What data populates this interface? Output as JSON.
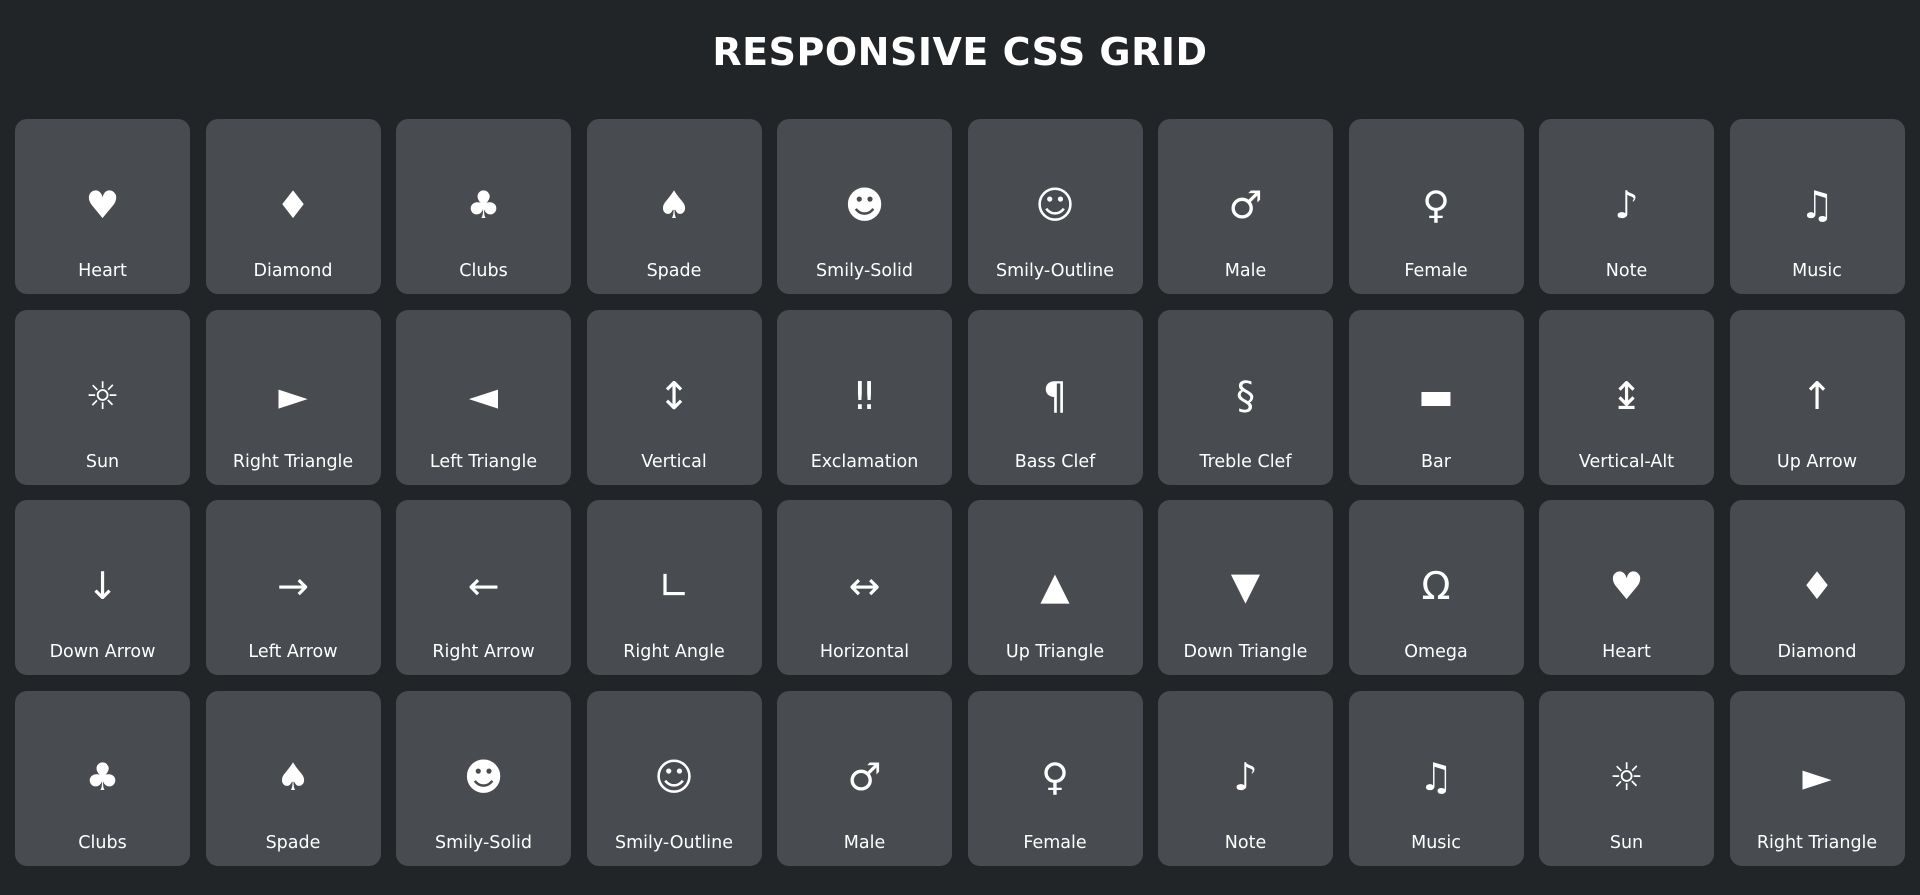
{
  "title": "RESPONSIVE CSS GRID",
  "tiles": [
    {
      "glyph": "♥",
      "label": "Heart",
      "icon": "heart-icon"
    },
    {
      "glyph": "♦",
      "label": "Diamond",
      "icon": "diamond-icon"
    },
    {
      "glyph": "♣",
      "label": "Clubs",
      "icon": "clubs-icon"
    },
    {
      "glyph": "♠",
      "label": "Spade",
      "icon": "spade-icon"
    },
    {
      "glyph": "☻",
      "label": "Smily-Solid",
      "icon": "smiley-solid-icon"
    },
    {
      "glyph": "☺",
      "label": "Smily-Outline",
      "icon": "smiley-outline-icon"
    },
    {
      "glyph": "♂",
      "label": "Male",
      "icon": "male-icon"
    },
    {
      "glyph": "♀",
      "label": "Female",
      "icon": "female-icon"
    },
    {
      "glyph": "♪",
      "label": "Note",
      "icon": "note-icon"
    },
    {
      "glyph": "♫",
      "label": "Music",
      "icon": "music-icon"
    },
    {
      "glyph": "☼",
      "label": "Sun",
      "icon": "sun-icon"
    },
    {
      "glyph": "►",
      "label": "Right Triangle",
      "icon": "right-triangle-icon"
    },
    {
      "glyph": "◄",
      "label": "Left Triangle",
      "icon": "left-triangle-icon"
    },
    {
      "glyph": "↕",
      "label": "Vertical",
      "icon": "vertical-arrow-icon"
    },
    {
      "glyph": "‼",
      "label": "Exclamation",
      "icon": "double-exclamation-icon"
    },
    {
      "glyph": "¶",
      "label": "Bass Clef",
      "icon": "pilcrow-icon"
    },
    {
      "glyph": "§",
      "label": "Treble Clef",
      "icon": "section-sign-icon"
    },
    {
      "glyph": "▬",
      "label": "Bar",
      "icon": "bar-icon"
    },
    {
      "glyph": "↨",
      "label": "Vertical-Alt",
      "icon": "vertical-alt-arrow-icon"
    },
    {
      "glyph": "↑",
      "label": "Up Arrow",
      "icon": "up-arrow-icon"
    },
    {
      "glyph": "↓",
      "label": "Down Arrow",
      "icon": "down-arrow-icon"
    },
    {
      "glyph": "→",
      "label": "Left Arrow",
      "icon": "right-pointing-arrow-icon"
    },
    {
      "glyph": "←",
      "label": "Right Arrow",
      "icon": "left-pointing-arrow-icon"
    },
    {
      "glyph": "∟",
      "label": "Right Angle",
      "icon": "right-angle-icon"
    },
    {
      "glyph": "↔",
      "label": "Horizontal",
      "icon": "horizontal-arrow-icon"
    },
    {
      "glyph": "▲",
      "label": "Up Triangle",
      "icon": "up-triangle-icon"
    },
    {
      "glyph": "▼",
      "label": "Down Triangle",
      "icon": "down-triangle-icon"
    },
    {
      "glyph": "Ω",
      "label": "Omega",
      "icon": "omega-icon"
    },
    {
      "glyph": "♥",
      "label": "Heart",
      "icon": "heart-icon"
    },
    {
      "glyph": "♦",
      "label": "Diamond",
      "icon": "diamond-icon"
    },
    {
      "glyph": "♣",
      "label": "Clubs",
      "icon": "clubs-icon"
    },
    {
      "glyph": "♠",
      "label": "Spade",
      "icon": "spade-icon"
    },
    {
      "glyph": "☻",
      "label": "Smily-Solid",
      "icon": "smiley-solid-icon"
    },
    {
      "glyph": "☺",
      "label": "Smily-Outline",
      "icon": "smiley-outline-icon"
    },
    {
      "glyph": "♂",
      "label": "Male",
      "icon": "male-icon"
    },
    {
      "glyph": "♀",
      "label": "Female",
      "icon": "female-icon"
    },
    {
      "glyph": "♪",
      "label": "Note",
      "icon": "note-icon"
    },
    {
      "glyph": "♫",
      "label": "Music",
      "icon": "music-icon"
    },
    {
      "glyph": "☼",
      "label": "Sun",
      "icon": "sun-icon"
    },
    {
      "glyph": "►",
      "label": "Right Triangle",
      "icon": "right-triangle-icon"
    }
  ]
}
